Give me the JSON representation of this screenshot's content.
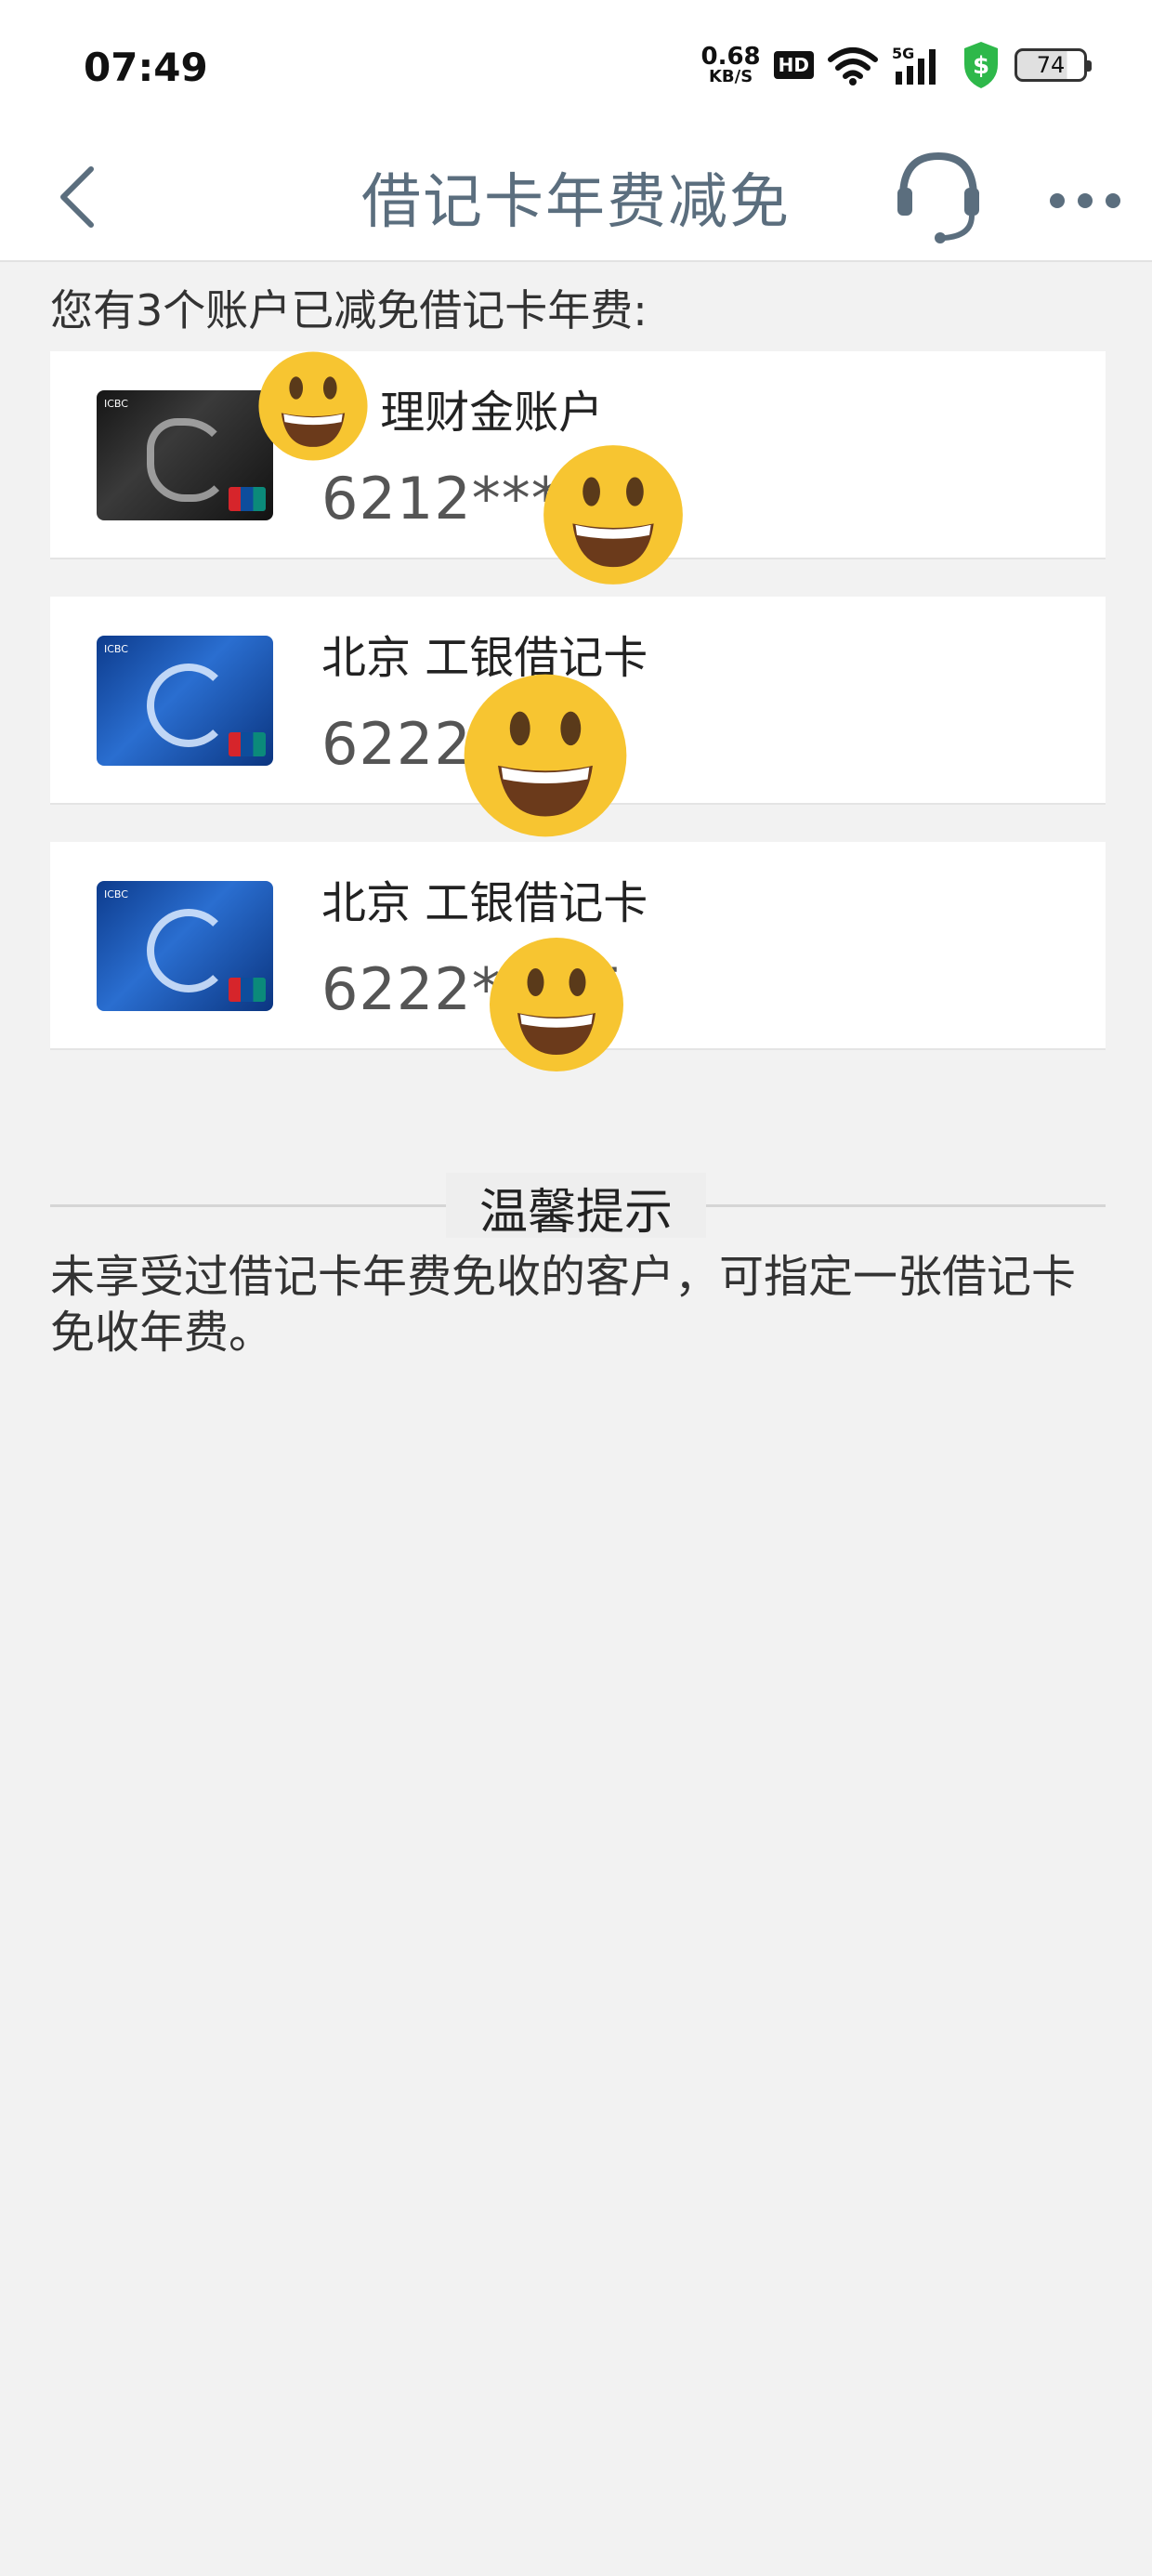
{
  "status_bar": {
    "time": "07:49",
    "net_speed_value": "0.68",
    "net_speed_unit": "KB/S",
    "hd": "HD",
    "network": "5G",
    "battery": "74"
  },
  "nav": {
    "title": "借记卡年费减免"
  },
  "summary": "您有3个账户已减免借记卡年费:",
  "accounts": [
    {
      "name": "州  理财金账户",
      "number": "6212****"
    },
    {
      "name": "北京  工银借记卡",
      "number": "6222*        15"
    },
    {
      "name": "北京  工银借记卡",
      "number": "6222**        15"
    }
  ],
  "tips": {
    "title": "温馨提示",
    "body": "未享受过借记卡年费免收的客户，可指定一张借记卡免收年费。"
  }
}
